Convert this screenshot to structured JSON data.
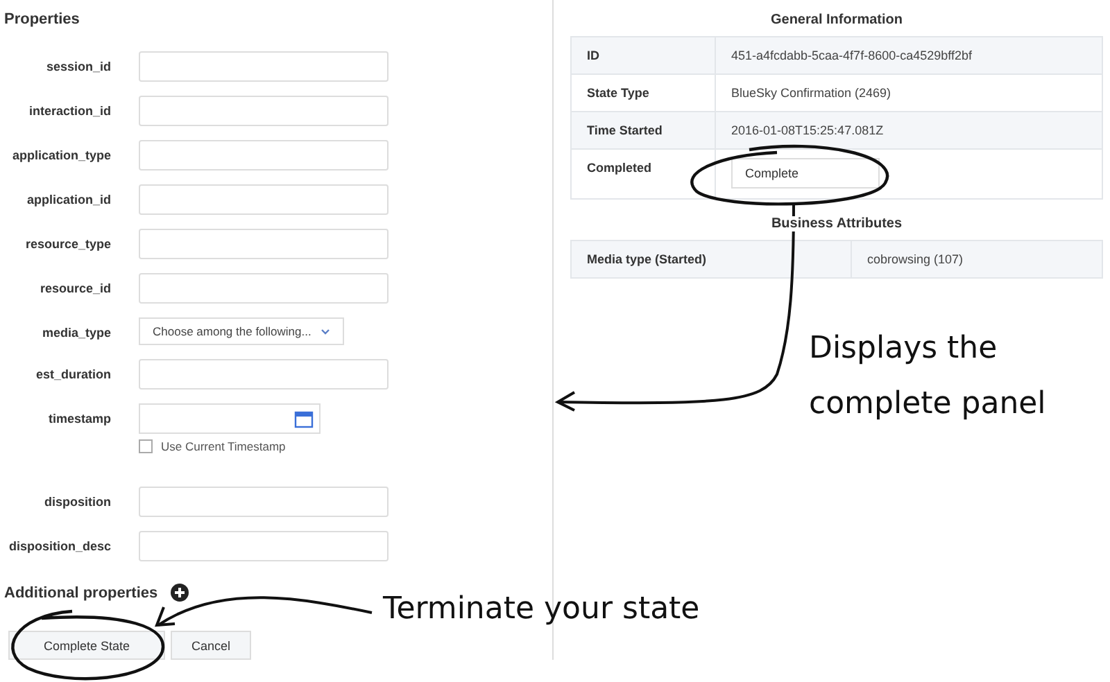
{
  "properties": {
    "title": "Properties",
    "fields": [
      {
        "label": "session_id",
        "kind": "text"
      },
      {
        "label": "interaction_id",
        "kind": "text"
      },
      {
        "label": "application_type",
        "kind": "text"
      },
      {
        "label": "application_id",
        "kind": "text"
      },
      {
        "label": "resource_type",
        "kind": "text"
      },
      {
        "label": "resource_id",
        "kind": "text"
      },
      {
        "label": "media_type",
        "kind": "select",
        "value": "Choose among the following..."
      },
      {
        "label": "est_duration",
        "kind": "text"
      },
      {
        "label": "timestamp",
        "kind": "date",
        "checkbox": {
          "label": "Use Current Timestamp",
          "checked": false
        }
      },
      {
        "label": "disposition",
        "kind": "text"
      },
      {
        "label": "disposition_desc",
        "kind": "text"
      }
    ],
    "additional_properties": "Additional properties",
    "buttons": [
      "Complete State",
      "Cancel"
    ]
  },
  "general_information": {
    "title": "General Information",
    "rows": [
      {
        "label": "ID",
        "kind": "text",
        "value": "451-a4fcdabb-5caa-4f7f-8600-ca4529bff2bf"
      },
      {
        "label": "State Type",
        "kind": "text",
        "value": "BlueSky Confirmation (2469)"
      },
      {
        "label": "Time Started",
        "kind": "text",
        "value": "2016-01-08T15:25:47.081Z"
      },
      {
        "label": "Completed",
        "kind": "button",
        "value": "Complete"
      }
    ]
  },
  "business_attributes": {
    "title": "Business Attributes",
    "rows": [
      {
        "label": "Media type (Started)",
        "value": "cobrowsing (107)"
      }
    ]
  },
  "annotations": [
    {
      "kind": "panel",
      "text": "Displays the complete panel"
    },
    {
      "kind": "button",
      "text": "Terminate your state"
    }
  ]
}
